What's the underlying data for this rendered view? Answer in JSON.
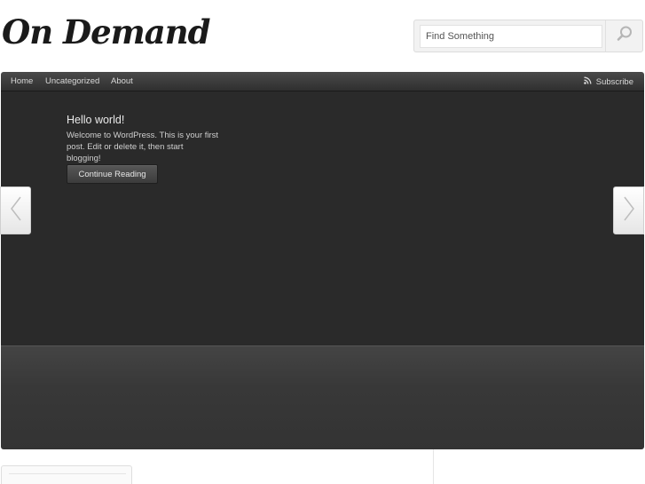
{
  "site": {
    "logo": "On Demand"
  },
  "search": {
    "placeholder": "Find Something",
    "icon": "search-icon"
  },
  "nav": {
    "items": [
      {
        "label": "Home"
      },
      {
        "label": "Uncategorized"
      },
      {
        "label": "About"
      }
    ],
    "subscribe_label": "Subscribe",
    "subscribe_icon": "rss-icon"
  },
  "slide": {
    "title": "Hello world!",
    "excerpt": "Welcome to WordPress. This is your first post. Edit or delete it, then start blogging!",
    "button_label": "Continue Reading"
  },
  "colors": {
    "navbar": "#3b3b3b",
    "slider_bg": "#2a2a2a",
    "thumbstrip_bg": "#3a3a3a"
  }
}
